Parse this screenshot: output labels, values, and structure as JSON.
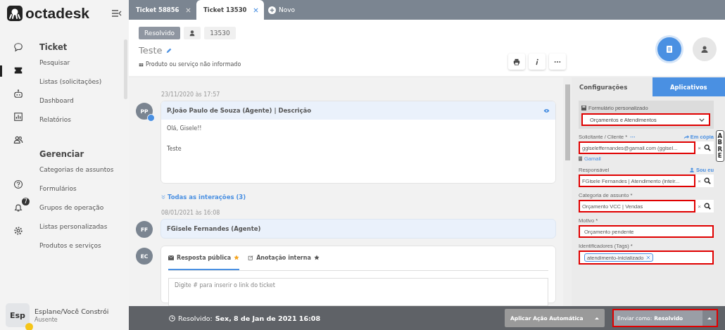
{
  "logo": {
    "text": "octadesk"
  },
  "rail": [
    {
      "kind": "chat",
      "selected": false
    },
    {
      "kind": "ticket",
      "selected": true
    },
    {
      "kind": "bot",
      "selected": false
    },
    {
      "kind": "report",
      "selected": false
    },
    {
      "kind": "people",
      "selected": false
    }
  ],
  "rail_bottom": [
    {
      "kind": "help"
    },
    {
      "kind": "bell",
      "badge": "7"
    },
    {
      "kind": "gear"
    }
  ],
  "nav": [
    {
      "heading": "Ticket",
      "items": [
        "Pesquisar",
        "Listas (solicitações)",
        "Dashboard",
        "Relatórios"
      ]
    },
    {
      "heading": "Gerenciar",
      "items": [
        "Categorias de assuntos",
        "Formulários",
        "Grupos de operação",
        "Listas personalizadas",
        "Produtos e serviços"
      ]
    }
  ],
  "user": {
    "initials": "Esp",
    "name": "Esplane/Você Constrói",
    "status": "Ausente",
    "away": true
  },
  "tabs": [
    {
      "label": "Ticket 58856",
      "selected": false
    },
    {
      "label": "Ticket 13530",
      "selected": true
    }
  ],
  "new_tab": "Novo",
  "ticket": {
    "status": "Resolvido",
    "number": "13530",
    "title": "Teste",
    "product": "Produto ou serviço não informado"
  },
  "interactions": [
    {
      "kind": "message",
      "date": "23/11/2020 às 17:57",
      "initials": "PP",
      "author": "P.João Paulo de Souza (Agente) | Descrição",
      "lines": [
        "Olá, Gisele!!",
        "Teste"
      ]
    },
    {
      "kind": "toggle",
      "label": "Todas as interações (3)"
    },
    {
      "kind": "note",
      "date": "08/01/2021 às 16:08",
      "initials": "FF",
      "author": "FGisele Fernandes (Agente)"
    },
    {
      "kind": "reply",
      "initials": "EC",
      "tabs": [
        {
          "label": "Resposta pública",
          "selected": true
        },
        {
          "label": "Anotação interna",
          "selected": false
        }
      ],
      "placeholder": "Digite # para inserir o link do ticket"
    }
  ],
  "panel": {
    "tabs": [
      {
        "label": "Configurações",
        "selected": true
      },
      {
        "label": "Aplicativos",
        "selected": false
      }
    ],
    "form": {
      "label": "Formulário personalizado",
      "value": "Orçamentos e Atendimentos",
      "highlighted": true
    },
    "fields": [
      {
        "kind": "lookup",
        "label": "Solicitante / Cliente *",
        "more": "···",
        "link": "Em cópia",
        "value": "ggiseleffernandes@gamail.com (ggisel...",
        "clear": "×",
        "highlighted": true,
        "note": "Gamail"
      },
      {
        "kind": "lookup",
        "label": "Responsável",
        "link": "Sou eu",
        "value": "FGisele Fernandes | Atendimento (inteir...",
        "clear": "×",
        "highlighted": true
      },
      {
        "kind": "lookup",
        "label": "Categoria de assunto *",
        "value": "Orçamento VCC | Vendas",
        "clear": "×",
        "highlighted": true
      },
      {
        "kind": "text",
        "label": "Motivo *",
        "value": "Orçamento pendente",
        "highlighted": true
      },
      {
        "kind": "tags",
        "label": "Identificadores (Tags) *",
        "tags": [
          "atendimento-inicializado"
        ],
        "highlighted": true
      }
    ],
    "side_tab": "ABRE"
  },
  "footer": {
    "label": "Resolvido:",
    "date": "Sex, 8 de Jan de 2021 16:08",
    "action": "Aplicar Ação Automática",
    "send_label": "Enviar como:",
    "send_value": "Resolvido",
    "send_highlighted": true
  }
}
